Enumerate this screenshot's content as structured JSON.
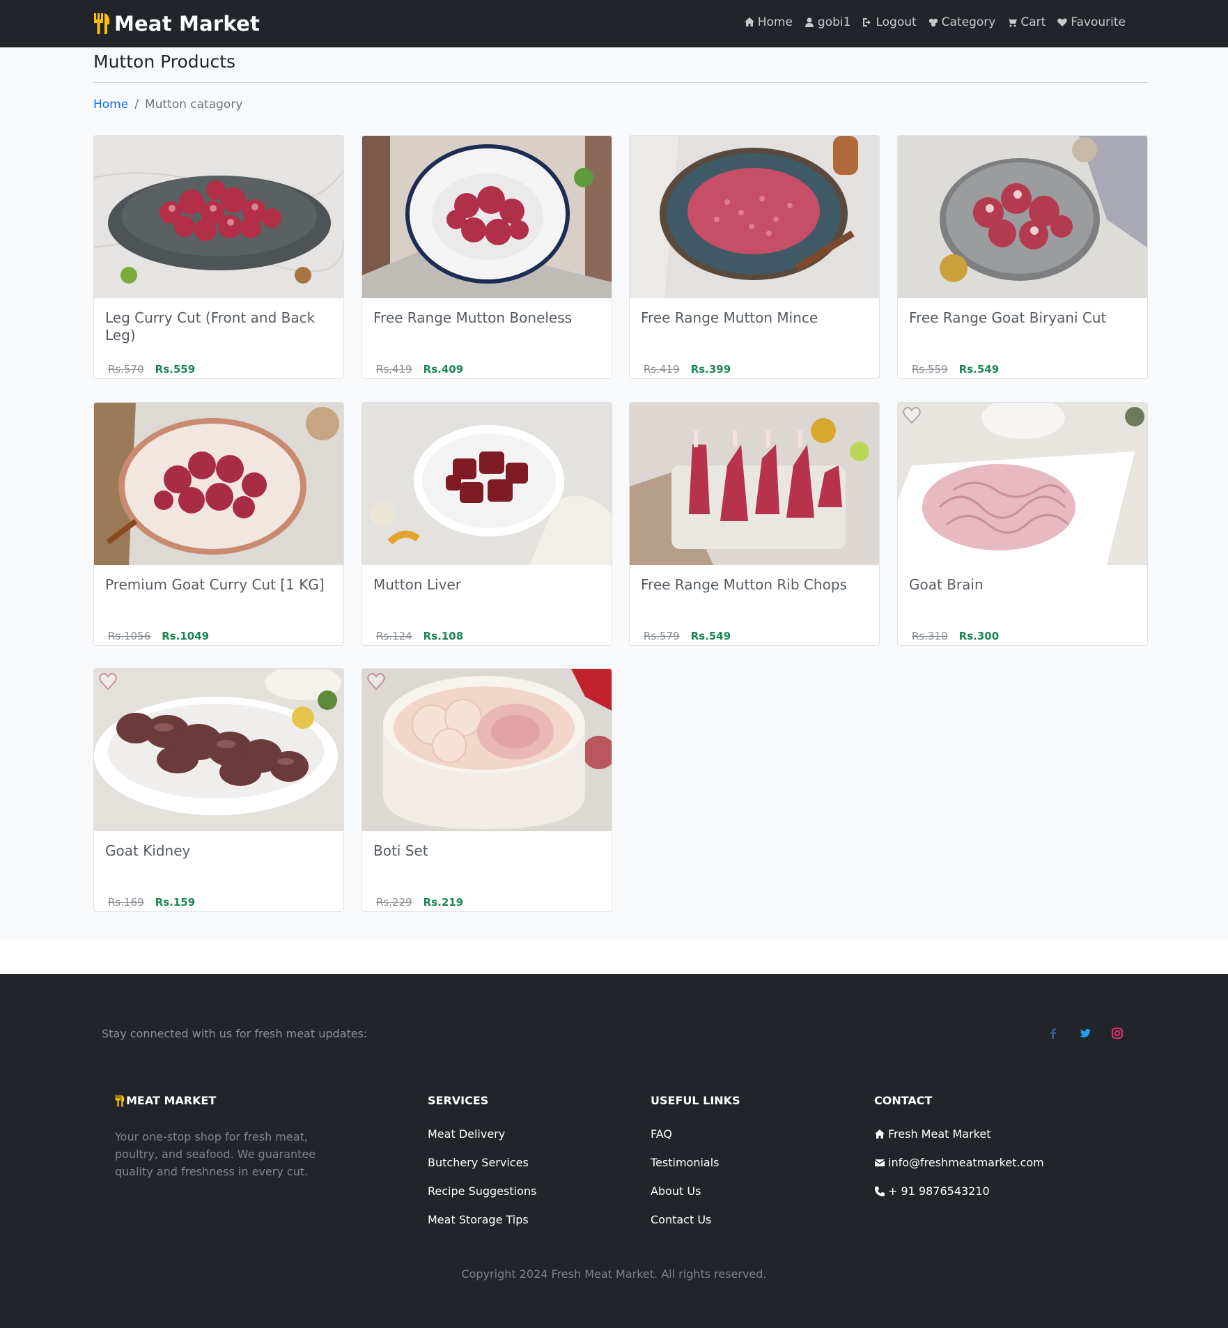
{
  "navbar": {
    "brand": "Meat Market",
    "links": [
      {
        "label": "Home",
        "icon": "home-icon"
      },
      {
        "label": "gobi1",
        "icon": "user-icon"
      },
      {
        "label": "Logout",
        "icon": "logout-icon"
      },
      {
        "label": "Category",
        "icon": "category-icon"
      },
      {
        "label": "Cart",
        "icon": "cart-icon"
      },
      {
        "label": "Favourite",
        "icon": "heart-icon"
      }
    ]
  },
  "page": {
    "title": "Mutton Products",
    "breadcrumb": {
      "home": "Home",
      "separator": "/",
      "current": "Mutton catagory"
    }
  },
  "products": [
    {
      "name": "Leg Curry Cut (Front and Back Leg)",
      "old_price": "Rs.570",
      "price": "Rs.559",
      "image": "mutton-curry-cut-image",
      "favourite": false
    },
    {
      "name": "Free Range Mutton Boneless",
      "old_price": "Rs.419",
      "price": "Rs.409",
      "image": "mutton-boneless-image",
      "favourite": false
    },
    {
      "name": "Free Range Mutton Mince",
      "old_price": "Rs.419",
      "price": "Rs.399",
      "image": "mutton-mince-image",
      "favourite": false
    },
    {
      "name": "Free Range Goat Biryani Cut",
      "old_price": "Rs.559",
      "price": "Rs.549",
      "image": "goat-biryani-cut-image",
      "favourite": false
    },
    {
      "name": "Premium Goat Curry Cut [1 KG]",
      "old_price": "Rs.1056",
      "price": "Rs.1049",
      "image": "goat-curry-cut-image",
      "favourite": false
    },
    {
      "name": "Mutton Liver",
      "old_price": "Rs.124",
      "price": "Rs.108",
      "image": "mutton-liver-image",
      "favourite": false
    },
    {
      "name": "Free Range Mutton Rib Chops",
      "old_price": "Rs.579",
      "price": "Rs.549",
      "image": "mutton-rib-chops-image",
      "favourite": false
    },
    {
      "name": "Goat Brain",
      "old_price": "Rs.310",
      "price": "Rs.300",
      "image": "goat-brain-image",
      "favourite": true
    },
    {
      "name": "Goat Kidney",
      "old_price": "Rs.169",
      "price": "Rs.159",
      "image": "goat-kidney-image",
      "favourite": true
    },
    {
      "name": "Boti Set",
      "old_price": "Rs.229",
      "price": "Rs.219",
      "image": "boti-set-image",
      "favourite": true
    }
  ],
  "footer": {
    "stay_connected": "Stay connected with us for fresh meat updates:",
    "social": [
      {
        "icon": "facebook-icon",
        "color": "#3b5998"
      },
      {
        "icon": "twitter-icon",
        "color": "#1da1f2"
      },
      {
        "icon": "instagram-icon",
        "color": "#e1306c"
      }
    ],
    "brand": {
      "title": "Meat Market",
      "description": "Your one-stop shop for fresh meat, poultry, and seafood. We guarantee quality and freshness in every cut."
    },
    "services": {
      "title": "Services",
      "items": [
        "Meat Delivery",
        "Butchery Services",
        "Recipe Suggestions",
        "Meat Storage Tips"
      ]
    },
    "useful_links": {
      "title": "Useful Links",
      "items": [
        "FAQ",
        "Testimonials",
        "About Us",
        "Contact Us"
      ]
    },
    "contact": {
      "title": "Contact",
      "items": [
        {
          "icon": "home-icon",
          "text": "Fresh Meat Market"
        },
        {
          "icon": "envelope-icon",
          "text": "info@freshmeatmarket.com"
        },
        {
          "icon": "phone-icon",
          "text": "+ 91 9876543210"
        }
      ]
    },
    "copyright": "Copyright 2024 Fresh Meat Market. All rights reserved."
  },
  "colors": {
    "navbar_bg": "#212529",
    "brand_icon": "#ffc107",
    "link": "#0d6efd",
    "price_green": "#198754",
    "old_price": "#8a8f94",
    "footer_bg": "#212529"
  }
}
